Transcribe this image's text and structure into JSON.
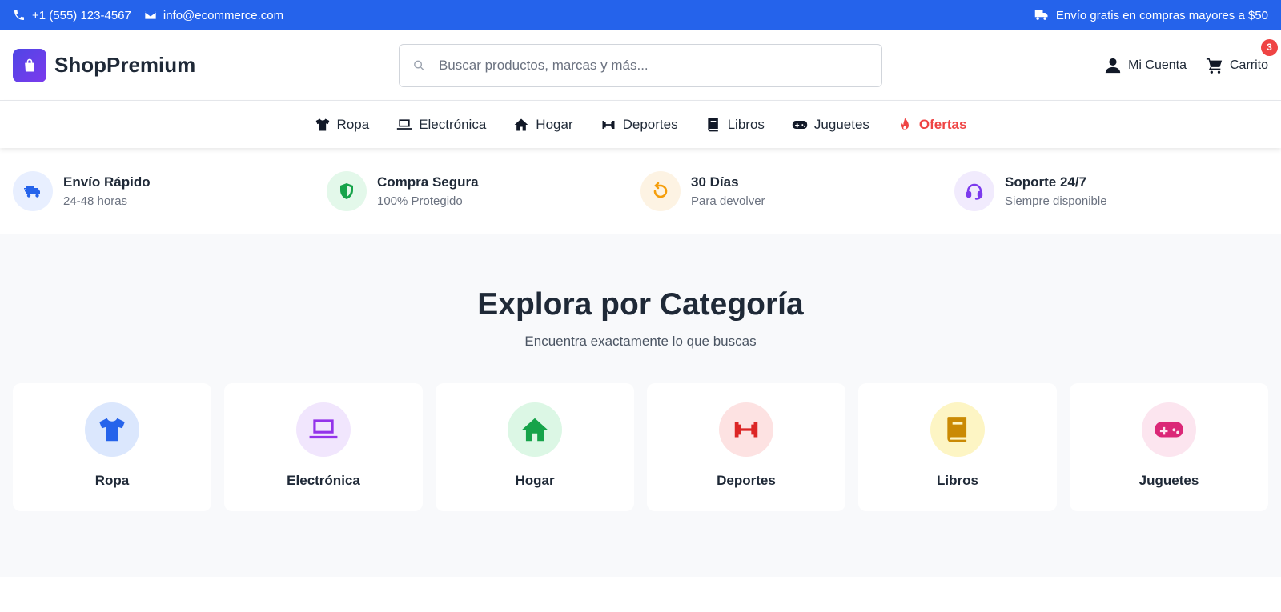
{
  "topbar": {
    "phone": "+1 (555) 123-4567",
    "email": "info@ecommerce.com",
    "shipping_notice": "Envío gratis en compras mayores a $50"
  },
  "header": {
    "brand": "ShopPremium",
    "search_placeholder": "Buscar productos, marcas y más...",
    "account_label": "Mi Cuenta",
    "cart_label": "Carrito",
    "cart_count": "3"
  },
  "nav": {
    "items": [
      {
        "label": "Ropa",
        "icon": "shirt-icon"
      },
      {
        "label": "Electrónica",
        "icon": "laptop-icon"
      },
      {
        "label": "Hogar",
        "icon": "home-icon"
      },
      {
        "label": "Deportes",
        "icon": "dumbbell-icon"
      },
      {
        "label": "Libros",
        "icon": "book-icon"
      },
      {
        "label": "Juguetes",
        "icon": "gamepad-icon"
      },
      {
        "label": "Ofertas",
        "icon": "fire-icon",
        "color": "#ef4444"
      }
    ]
  },
  "features": [
    {
      "title": "Envío Rápido",
      "subtitle": "24-48 horas",
      "icon": "truck-icon",
      "color": "#2563eb",
      "bg": "#e8efff"
    },
    {
      "title": "Compra Segura",
      "subtitle": "100% Protegido",
      "icon": "shield-icon",
      "color": "#16a34a",
      "bg": "#e3f8ea"
    },
    {
      "title": "30 Días",
      "subtitle": "Para devolver",
      "icon": "return-icon",
      "color": "#f59e0b",
      "bg": "#fdf3e3"
    },
    {
      "title": "Soporte 24/7",
      "subtitle": "Siempre disponible",
      "icon": "headset-icon",
      "color": "#7c3aed",
      "bg": "#f1ebfd"
    }
  ],
  "categories": {
    "title": "Explora por Categoría",
    "subtitle": "Encuentra exactamente lo que buscas",
    "items": [
      {
        "label": "Ropa",
        "icon": "shirt-icon",
        "color": "#2563eb",
        "bg": "#dbe7fd"
      },
      {
        "label": "Electrónica",
        "icon": "laptop-icon",
        "color": "#9333ea",
        "bg": "#f1e6fd"
      },
      {
        "label": "Hogar",
        "icon": "home-icon",
        "color": "#16a34a",
        "bg": "#dcf7e5"
      },
      {
        "label": "Deportes",
        "icon": "dumbbell-icon",
        "color": "#dc2626",
        "bg": "#fde2e2"
      },
      {
        "label": "Libros",
        "icon": "book-icon",
        "color": "#ca8a04",
        "bg": "#fdf5c4"
      },
      {
        "label": "Juguetes",
        "icon": "gamepad-icon",
        "color": "#db2777",
        "bg": "#fce5ef"
      }
    ]
  }
}
